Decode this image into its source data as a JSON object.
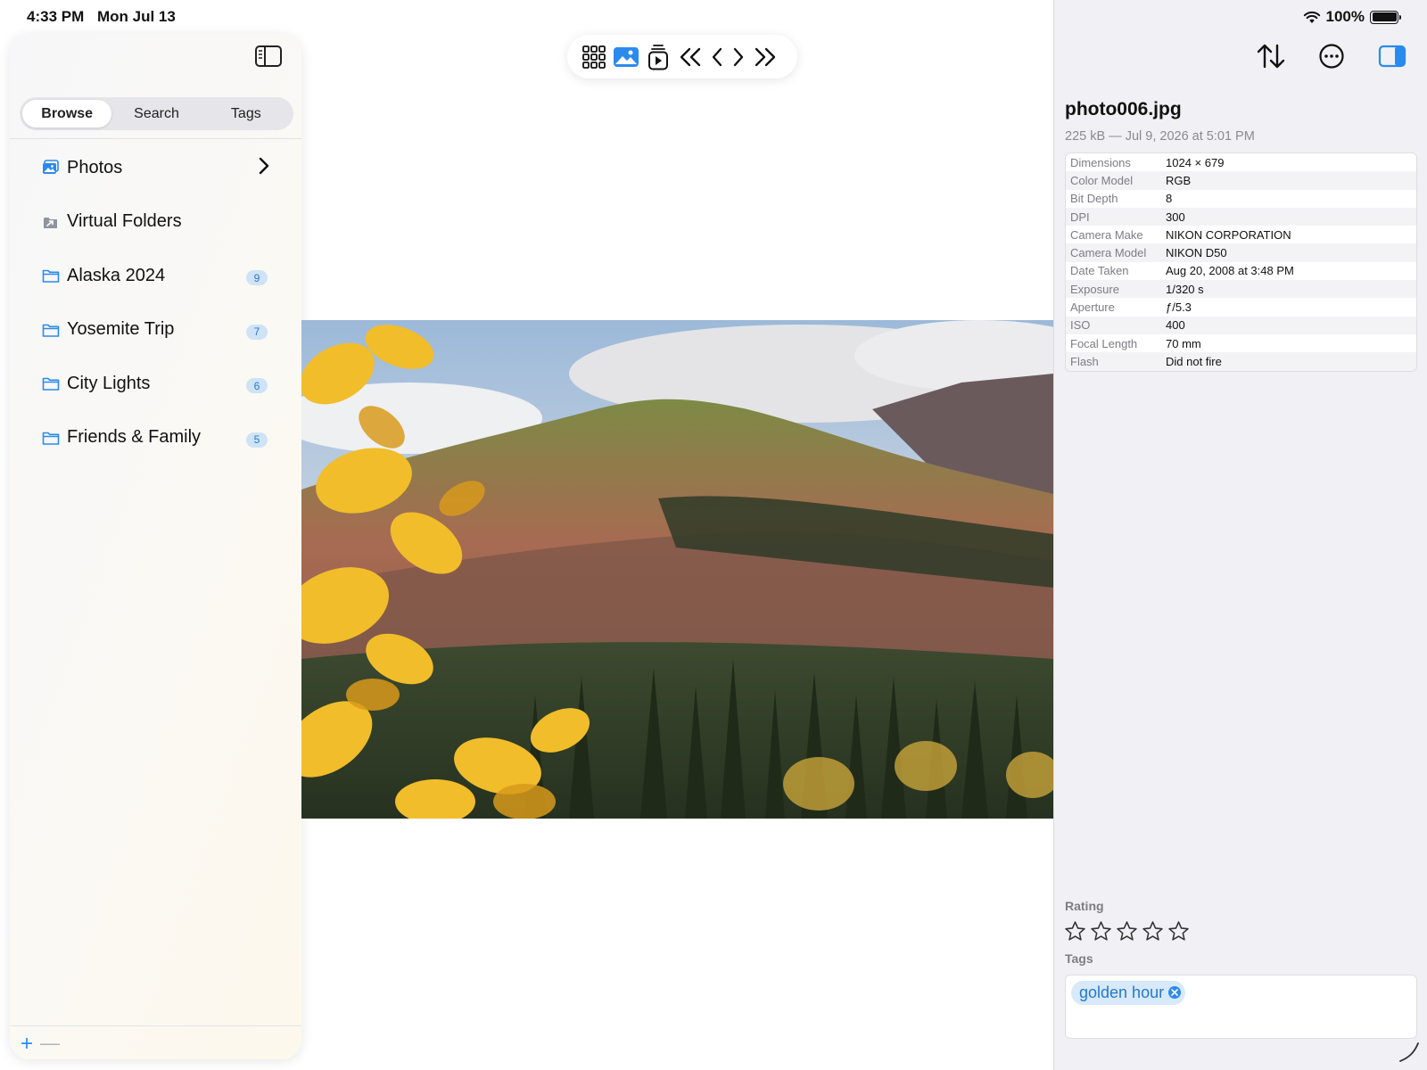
{
  "status_bar": {
    "time": "4:33 PM",
    "date": "Mon Jul 13",
    "battery": "100%"
  },
  "sidebar": {
    "segments": [
      "Browse",
      "Search",
      "Tags"
    ],
    "active_segment": "Browse",
    "items": [
      {
        "label": "Photos",
        "icon": "photos-icon"
      },
      {
        "label": "Virtual Folders",
        "icon": "virtual-folder-icon"
      },
      {
        "label": "Alaska 2024",
        "icon": "folder-icon",
        "count": "9"
      },
      {
        "label": "Yosemite Trip",
        "icon": "folder-icon",
        "count": "7"
      },
      {
        "label": "City Lights",
        "icon": "folder-icon",
        "count": "6"
      },
      {
        "label": "Friends & Family",
        "icon": "folder-icon",
        "count": "5"
      }
    ],
    "add_label": "+",
    "remove_label": "—"
  },
  "toolbar": {
    "buttons": [
      "grid-icon",
      "photo-icon",
      "slideshow-icon",
      "first-icon",
      "previous-icon",
      "next-icon",
      "last-icon"
    ]
  },
  "inspector": {
    "file_name": "photo006.jpg",
    "file_info": "225 kB — Jul 9, 2026 at 5:01 PM",
    "metadata": [
      {
        "key": "Dimensions",
        "value": "1024 × 679"
      },
      {
        "key": "Color Model",
        "value": "RGB"
      },
      {
        "key": "Bit Depth",
        "value": "8"
      },
      {
        "key": "DPI",
        "value": "300"
      },
      {
        "key": "Camera Make",
        "value": "NIKON CORPORATION"
      },
      {
        "key": "Camera Model",
        "value": "NIKON D50"
      },
      {
        "key": "Date Taken",
        "value": "Aug 20, 2008 at 3:48 PM"
      },
      {
        "key": "Exposure",
        "value": "1/320 s"
      },
      {
        "key": "Aperture",
        "value": "ƒ/5.3"
      },
      {
        "key": "ISO",
        "value": "400"
      },
      {
        "key": "Focal Length",
        "value": "70 mm"
      },
      {
        "key": "Flash",
        "value": "Did not fire"
      }
    ],
    "rating_label": "Rating",
    "rating": 0,
    "rating_max": 5,
    "tags_label": "Tags",
    "tags": [
      "golden hour"
    ]
  },
  "colors": {
    "accent": "#2b8aed",
    "badge_bg": "#cfe3f7",
    "badge_text": "#2b78c8"
  }
}
